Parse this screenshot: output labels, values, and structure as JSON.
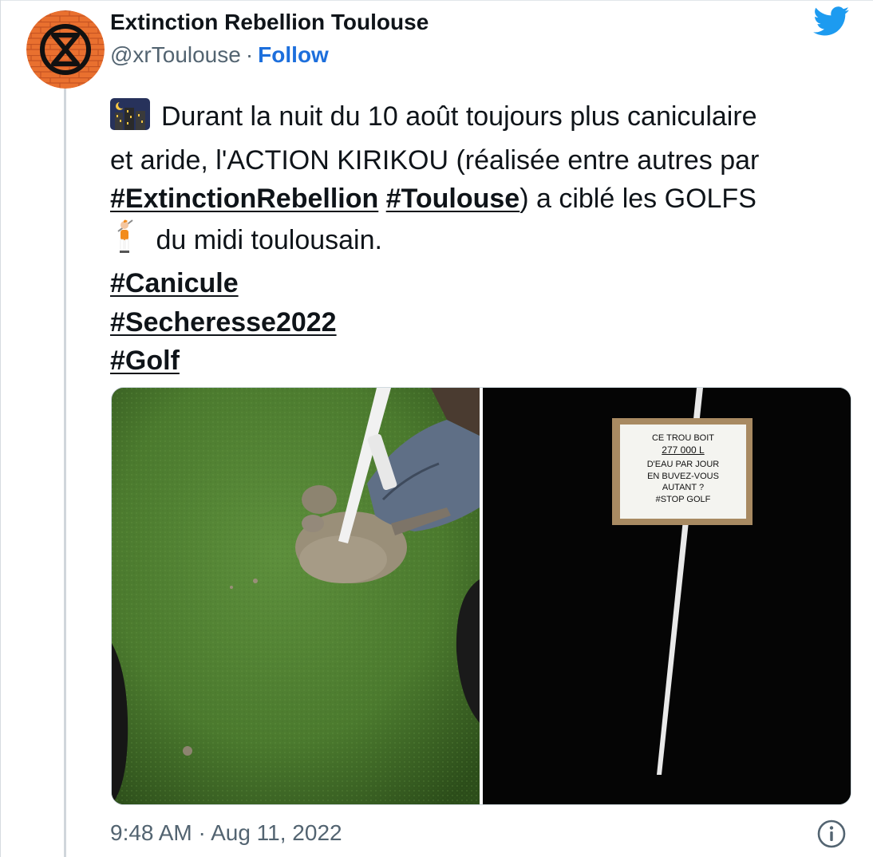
{
  "author": {
    "name": "Extinction Rebellion Toulouse",
    "handle": "@xrToulouse",
    "separator": "·",
    "follow_label": "Follow"
  },
  "tweet": {
    "emoji_city": "night-city-emoji",
    "emoji_golfer": "golfer-emoji",
    "line1": "Durant la nuit du 10 août toujours plus caniculaire",
    "line2": "et aride, l'ACTION KIRIKOU (réalisée entre autres par",
    "hashtag1": "#ExtinctionRebellion",
    "hashtag2": "#Toulouse",
    "line3_rest": ") a ciblé les GOLFS",
    "line4": " du midi toulousain.",
    "hashtags": [
      "#Canicule",
      "#Secheresse2022",
      "#Golf"
    ]
  },
  "media": {
    "sign": {
      "line1": "CE TROU BOIT",
      "line2": "277  000  L",
      "line3": "D'EAU PAR JOUR",
      "line4": "EN  BUVEZ-VOUS",
      "line5": "AUTANT ?",
      "line6": "#STOP  GOLF"
    }
  },
  "footer": {
    "timestamp": "9:48 AM · Aug 11, 2022",
    "info_icon": "info-icon"
  },
  "colors": {
    "link": "#1d6fdc",
    "twitter_blue": "#1d9bf0",
    "secondary_text": "#536471",
    "avatar_orange": "#e8692a"
  }
}
